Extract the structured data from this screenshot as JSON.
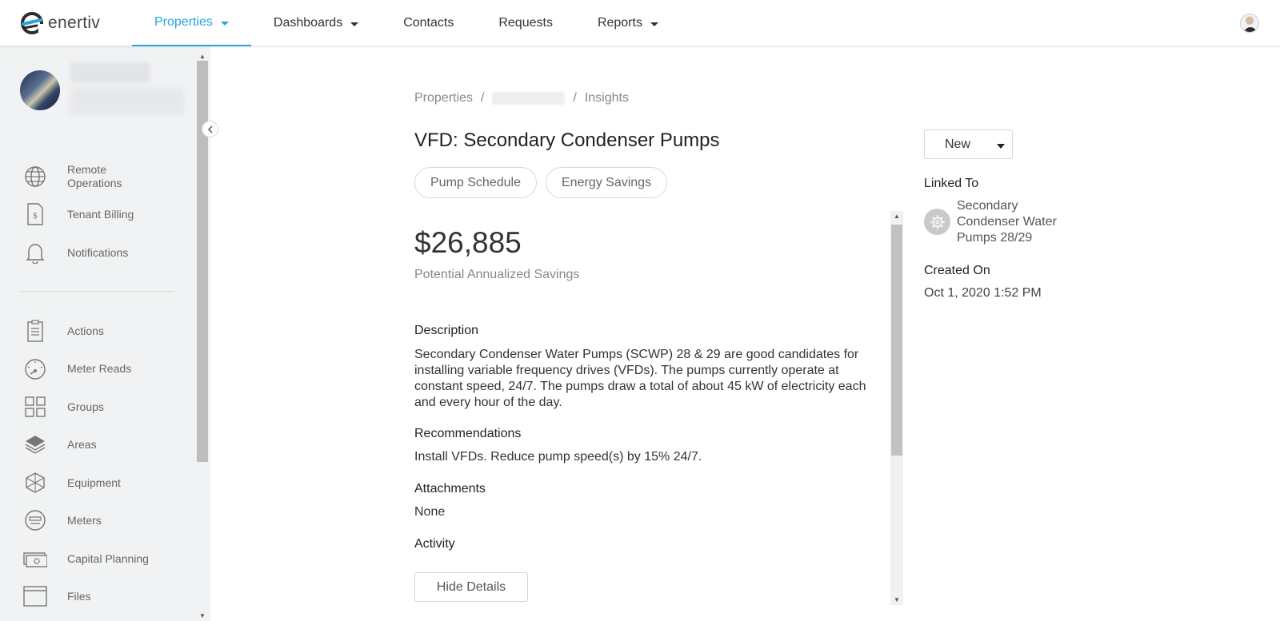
{
  "app": {
    "logo_text": "enertiv"
  },
  "nav": {
    "items": [
      {
        "label": "Properties",
        "active": true,
        "has_caret": true
      },
      {
        "label": "Dashboards",
        "active": false,
        "has_caret": true
      },
      {
        "label": "Contacts",
        "active": false,
        "has_caret": false
      },
      {
        "label": "Requests",
        "active": false,
        "has_caret": false
      },
      {
        "label": "Reports",
        "active": false,
        "has_caret": true
      }
    ],
    "accent_color": "#29a3dc"
  },
  "sidebar": {
    "items": [
      {
        "label": "Remote Operations",
        "icon": "globe-icon"
      },
      {
        "label": "Tenant Billing",
        "icon": "invoice-dollar-icon"
      },
      {
        "label": "Notifications",
        "icon": "bell-icon"
      },
      {
        "label": "Actions",
        "icon": "clipboard-icon"
      },
      {
        "label": "Meter Reads",
        "icon": "gauge-icon"
      },
      {
        "label": "Groups",
        "icon": "grid-icon"
      },
      {
        "label": "Areas",
        "icon": "layers-icon"
      },
      {
        "label": "Equipment",
        "icon": "cube-icon"
      },
      {
        "label": "Meters",
        "icon": "meter-icon"
      },
      {
        "label": "Capital Planning",
        "icon": "money-icon"
      },
      {
        "label": "Files",
        "icon": "folder-icon"
      }
    ]
  },
  "breadcrumb": {
    "root": "Properties",
    "separator": "/",
    "current": "Insights"
  },
  "insight": {
    "title": "VFD: Secondary Condenser Pumps",
    "tags": [
      "Pump Schedule",
      "Energy Savings"
    ],
    "savings_amount": "$26,885",
    "savings_label": "Potential Annualized Savings",
    "description_heading": "Description",
    "description_lines": [
      "Secondary Condenser Water Pumps (SCWP) 28 & 29 are good candidates for",
      "installing variable frequency drives (VFDs). The pumps currently operate at",
      "constant speed, 24/7. The pumps draw a total of about 45 kW of electricity each",
      "and every hour of the day."
    ],
    "recommendations_heading": "Recommendations",
    "recommendations_text": "Install VFDs. Reduce pump speed(s) by 15% 24/7.",
    "attachments_heading": "Attachments",
    "attachments_text": "None",
    "activity_heading": "Activity",
    "hide_details_label": "Hide Details"
  },
  "right_panel": {
    "status": "New",
    "linked_to_label": "Linked To",
    "linked_lines": [
      "Secondary",
      "Condenser Water",
      "Pumps 28/29"
    ],
    "created_on_label": "Created On",
    "created_on_value": "Oct 1, 2020 1:52 PM"
  }
}
